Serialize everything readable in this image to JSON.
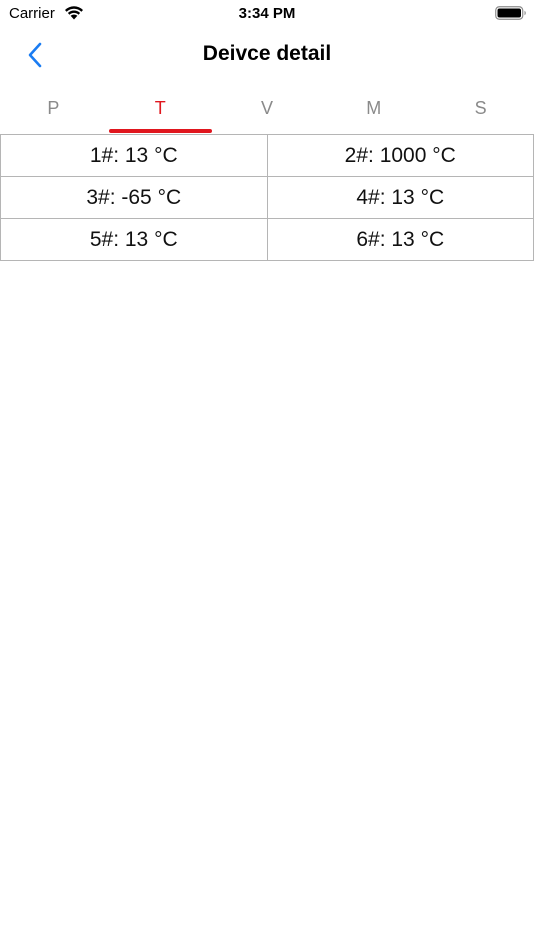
{
  "status_bar": {
    "carrier": "Carrier",
    "time": "3:34 PM",
    "wifi_icon": "wifi-icon",
    "battery_icon": "battery-full-icon"
  },
  "nav": {
    "title": "Deivce detail",
    "back_icon": "chevron-left-icon"
  },
  "colors": {
    "accent": "#e0161e",
    "back_blue": "#1a7cf2",
    "tab_inactive": "#8a8a8a",
    "grid_border": "#b5b5b5"
  },
  "tabs": [
    {
      "label": "P",
      "active": false
    },
    {
      "label": "T",
      "active": true
    },
    {
      "label": "V",
      "active": false
    },
    {
      "label": "M",
      "active": false
    },
    {
      "label": "S",
      "active": false
    }
  ],
  "readings": [
    [
      "1#: 13 °C",
      "2#: 1000 °C"
    ],
    [
      "3#: -65 °C",
      "4#: 13 °C"
    ],
    [
      "5#: 13 °C",
      "6#: 13 °C"
    ]
  ]
}
